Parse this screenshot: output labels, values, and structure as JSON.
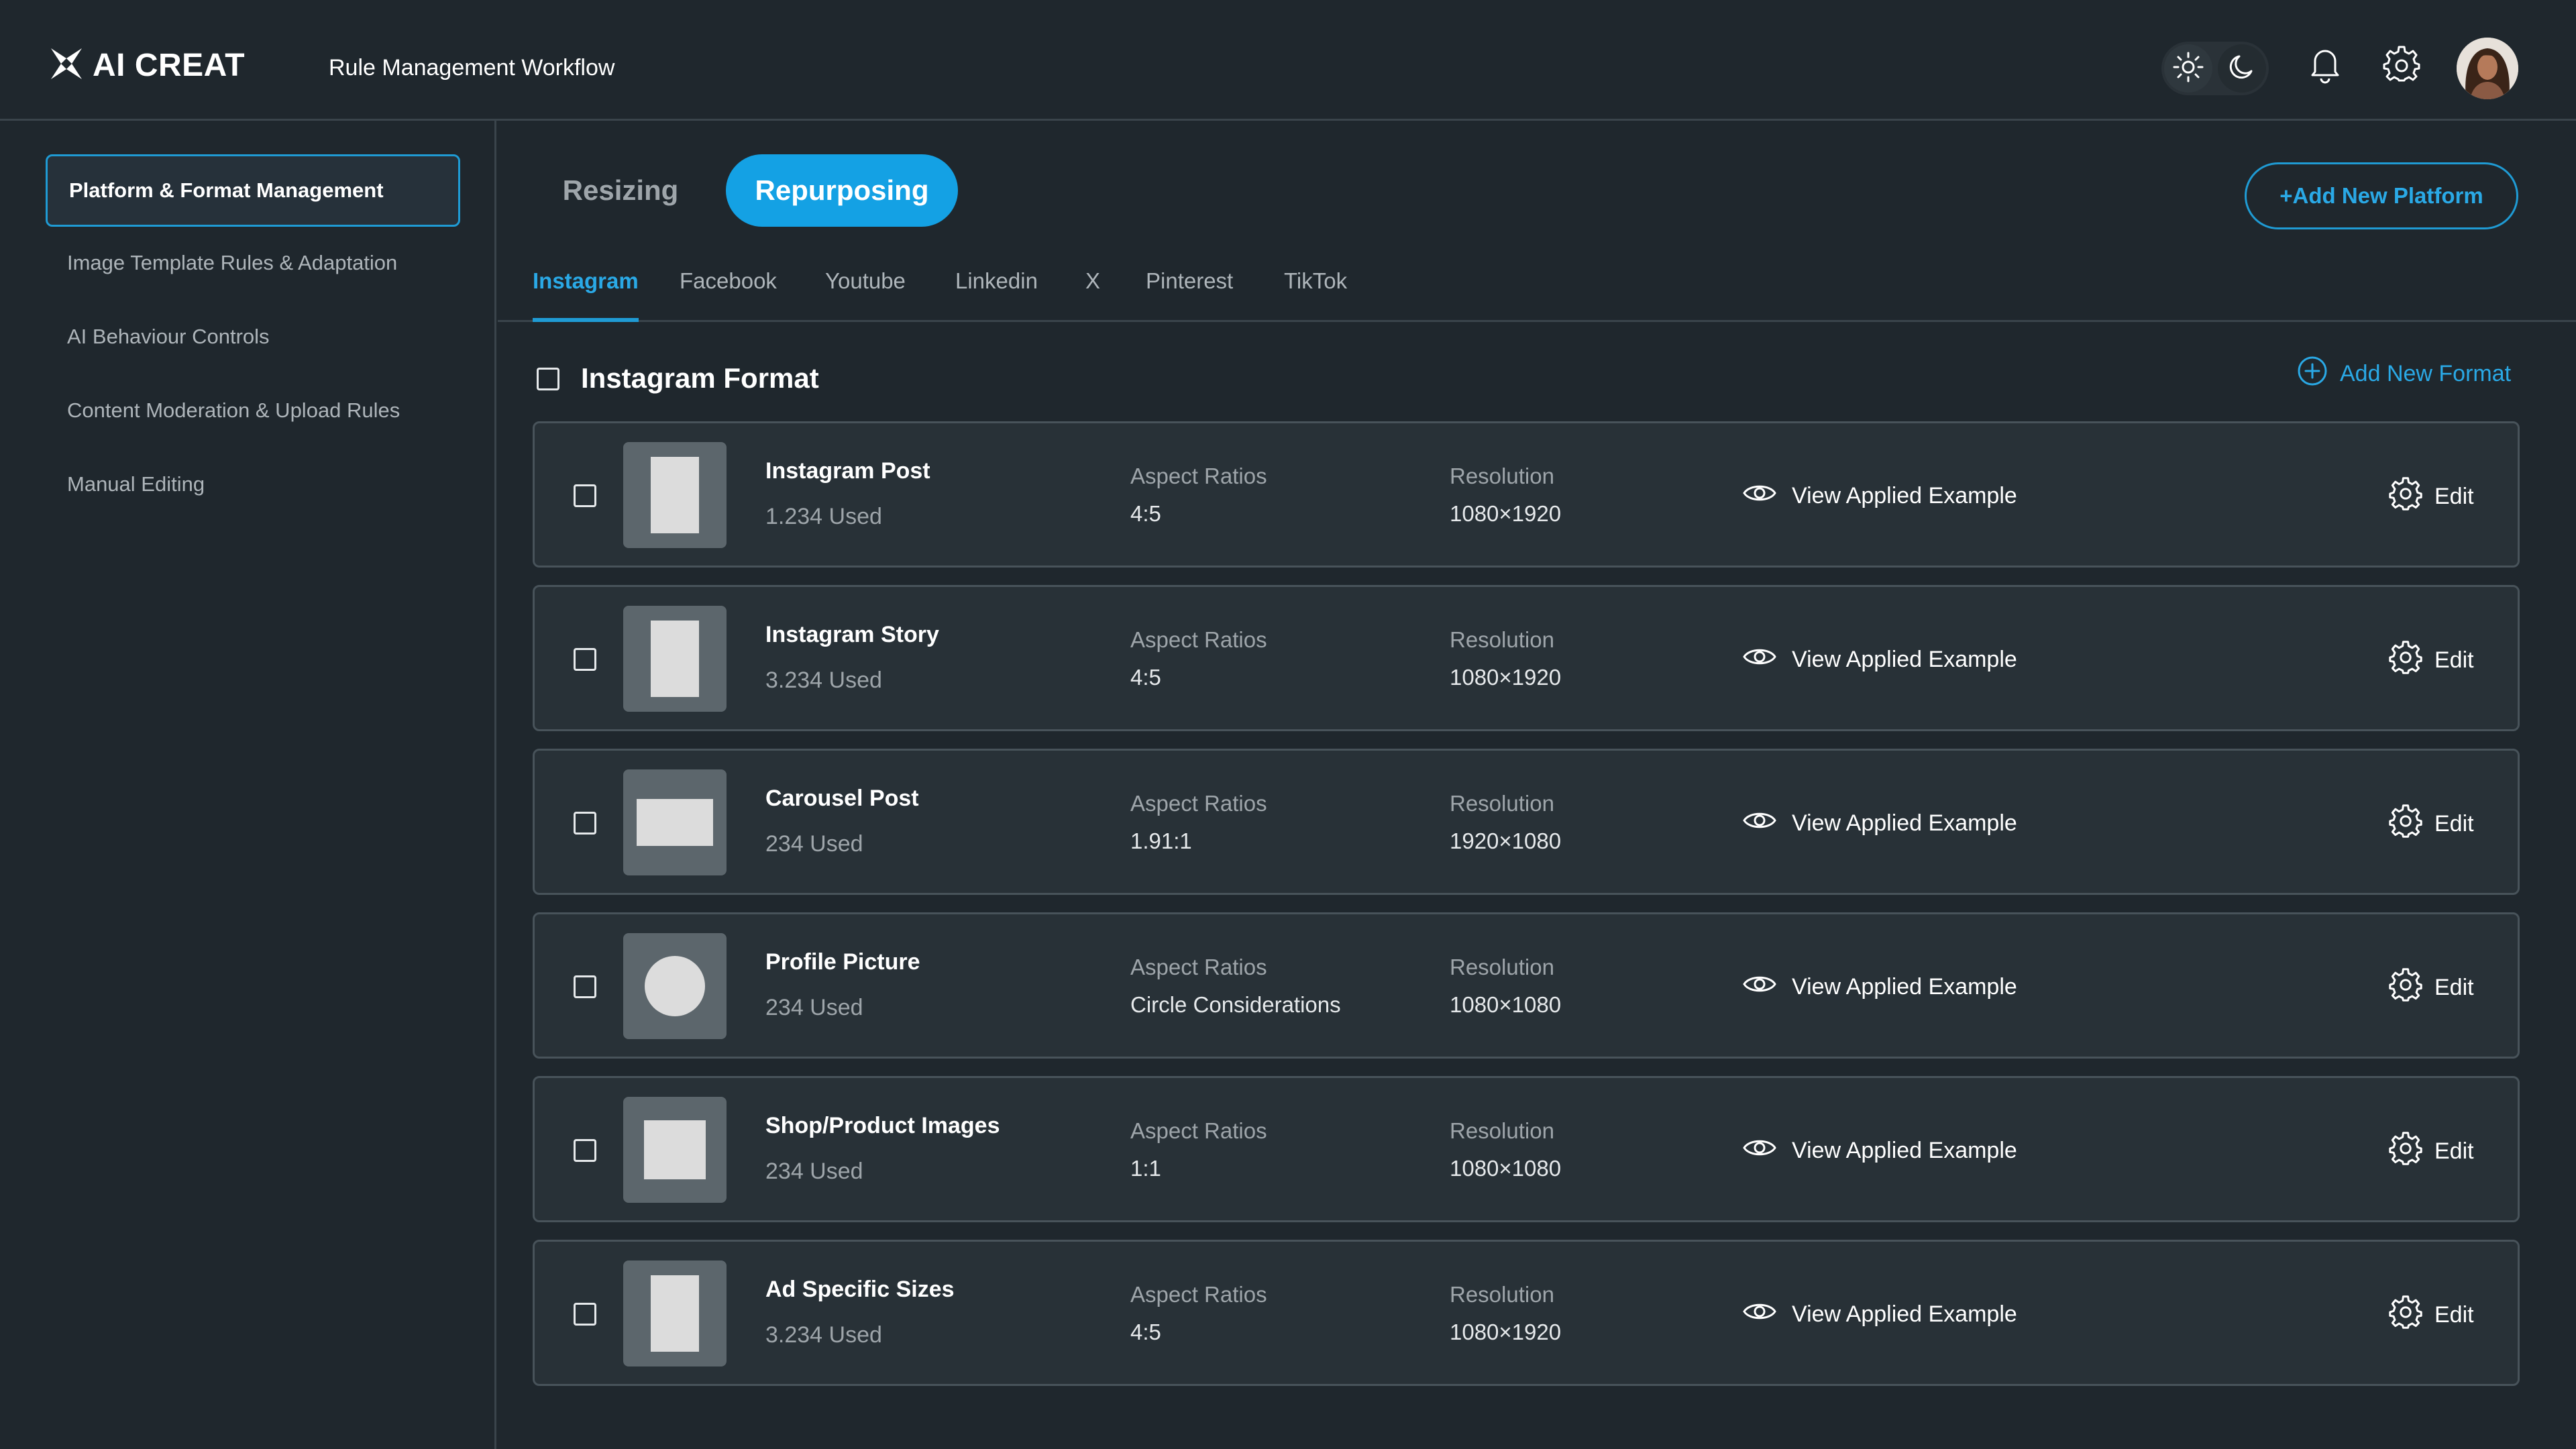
{
  "brand": {
    "logo_text": "AI CREAT"
  },
  "header": {
    "title": "Rule Management Workflow"
  },
  "sidebar": {
    "items": [
      {
        "label": "Platform & Format Management",
        "active": true
      },
      {
        "label": "Image Template Rules & Adaptation"
      },
      {
        "label": "AI Behaviour Controls"
      },
      {
        "label": "Content Moderation & Upload Rules"
      },
      {
        "label": "Manual Editing"
      }
    ]
  },
  "modes": [
    {
      "label": "Resizing"
    },
    {
      "label": "Repurposing",
      "active": true
    }
  ],
  "add_platform_label": "+Add New Platform",
  "platform_tabs": [
    {
      "label": "Instagram",
      "active": true
    },
    {
      "label": "Facebook"
    },
    {
      "label": "Youtube"
    },
    {
      "label": "Linkedin"
    },
    {
      "label": "X"
    },
    {
      "label": "Pinterest"
    },
    {
      "label": "TikTok"
    }
  ],
  "format_section": {
    "title": "Instagram Format",
    "add_format_label": "Add New Format"
  },
  "labels": {
    "aspect": "Aspect Ratios",
    "resolution": "Resolution",
    "view": "View Applied Example",
    "edit": "Edit"
  },
  "formats": [
    {
      "name": "Instagram Post",
      "used": "1.234 Used",
      "aspect": "4:5",
      "resolution": "1080×1920",
      "thumb": "portrait"
    },
    {
      "name": "Instagram Story",
      "used": "3.234 Used",
      "aspect": "4:5",
      "resolution": "1080×1920",
      "thumb": "portrait"
    },
    {
      "name": "Carousel Post",
      "used": "234 Used",
      "aspect": "1.91:1",
      "resolution": "1920×1080",
      "thumb": "landscape"
    },
    {
      "name": "Profile Picture",
      "used": "234 Used",
      "aspect": "Circle Considerations",
      "resolution": "1080×1080",
      "thumb": "circle"
    },
    {
      "name": "Shop/Product Images",
      "used": "234 Used",
      "aspect": "1:1",
      "resolution": "1080×1080",
      "thumb": "square"
    },
    {
      "name": "Ad Specific Sizes",
      "used": "3.234 Used",
      "aspect": "4:5",
      "resolution": "1080×1920",
      "thumb": "portrait"
    }
  ],
  "colors": {
    "accent": "#14a1e4",
    "background": "#1f272d",
    "card": "#283137"
  },
  "icons": {
    "logo": "logo-mark-icon",
    "sun": "sun-icon",
    "moon": "moon-icon",
    "bell": "bell-icon",
    "settings": "gear-icon",
    "view": "eye-icon",
    "edit": "gear-icon",
    "add": "plus-circle-icon"
  }
}
